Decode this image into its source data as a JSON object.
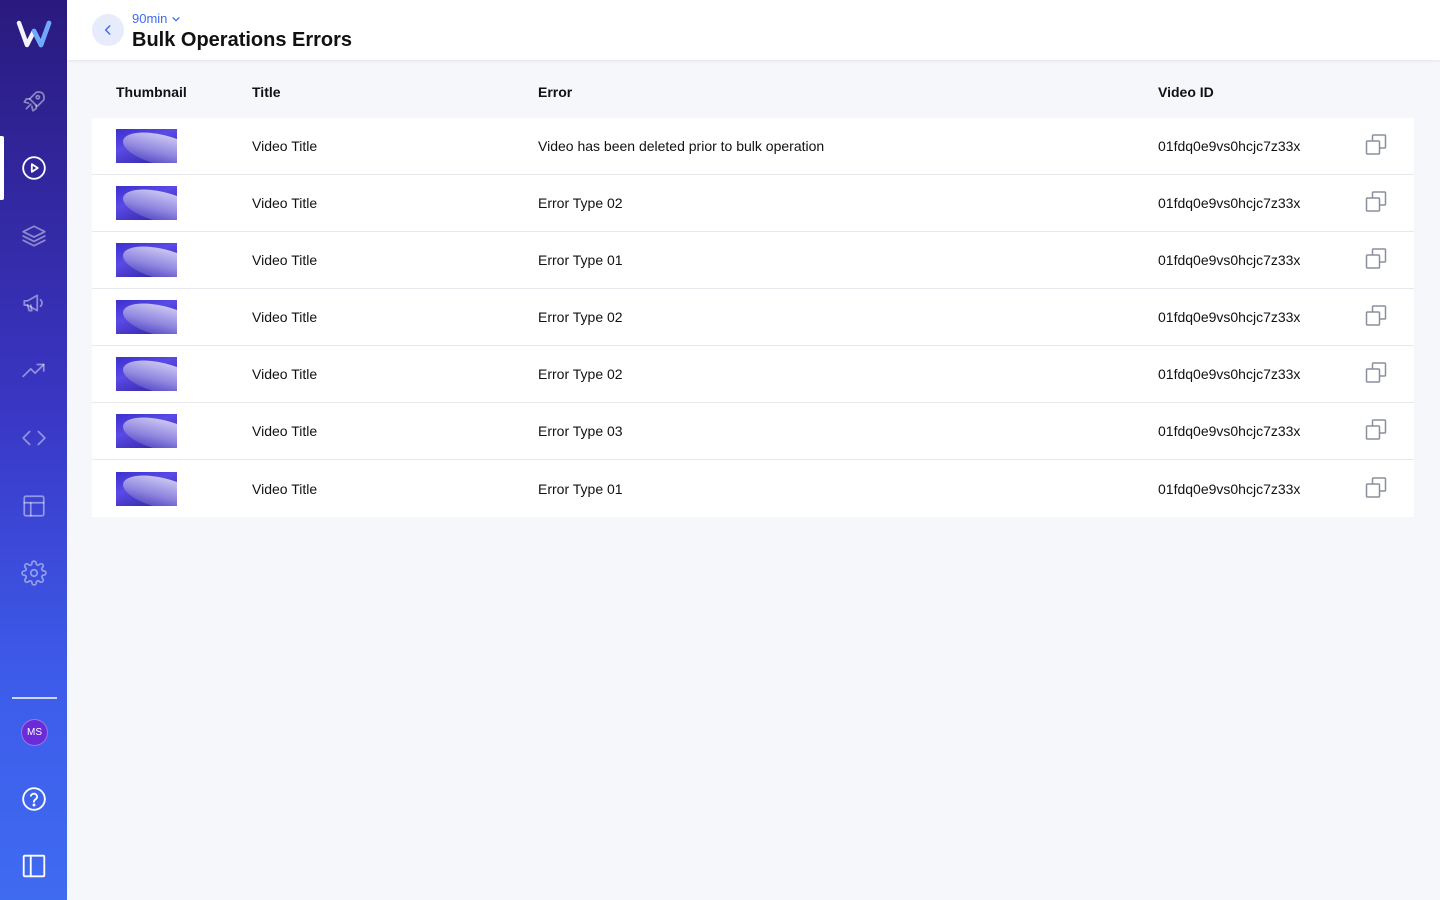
{
  "sidebar": {
    "items": [
      {
        "icon": "rocket-icon"
      },
      {
        "icon": "play-circle-icon",
        "active": true
      },
      {
        "icon": "layers-icon"
      },
      {
        "icon": "megaphone-icon"
      },
      {
        "icon": "trending-up-icon"
      },
      {
        "icon": "code-icon"
      },
      {
        "icon": "layout-icon"
      },
      {
        "icon": "gear-icon"
      }
    ],
    "avatar_initials": "MS",
    "bottom": [
      {
        "icon": "help-icon"
      },
      {
        "icon": "sidebar-toggle-icon"
      }
    ]
  },
  "header": {
    "breadcrumb": "90min",
    "title": "Bulk Operations Errors"
  },
  "table": {
    "columns": {
      "thumbnail": "Thumbnail",
      "title": "Title",
      "error": "Error",
      "video_id": "Video ID"
    },
    "rows": [
      {
        "title": "Video Title",
        "error": "Video has been deleted prior to bulk operation",
        "video_id": "01fdq0e9vs0hcjc7z33x"
      },
      {
        "title": "Video Title",
        "error": "Error Type 02",
        "video_id": "01fdq0e9vs0hcjc7z33x"
      },
      {
        "title": "Video Title",
        "error": "Error Type 01",
        "video_id": "01fdq0e9vs0hcjc7z33x"
      },
      {
        "title": "Video Title",
        "error": "Error Type 02",
        "video_id": "01fdq0e9vs0hcjc7z33x"
      },
      {
        "title": "Video Title",
        "error": "Error Type 02",
        "video_id": "01fdq0e9vs0hcjc7z33x"
      },
      {
        "title": "Video Title",
        "error": "Error Type 03",
        "video_id": "01fdq0e9vs0hcjc7z33x"
      },
      {
        "title": "Video Title",
        "error": "Error Type 01",
        "video_id": "01fdq0e9vs0hcjc7z33x"
      }
    ]
  },
  "colors": {
    "accent": "#3f6bf1",
    "sidebar_top": "#2a1a7e",
    "sidebar_bottom": "#3f6bf1",
    "avatar": "#6a2bd8"
  }
}
